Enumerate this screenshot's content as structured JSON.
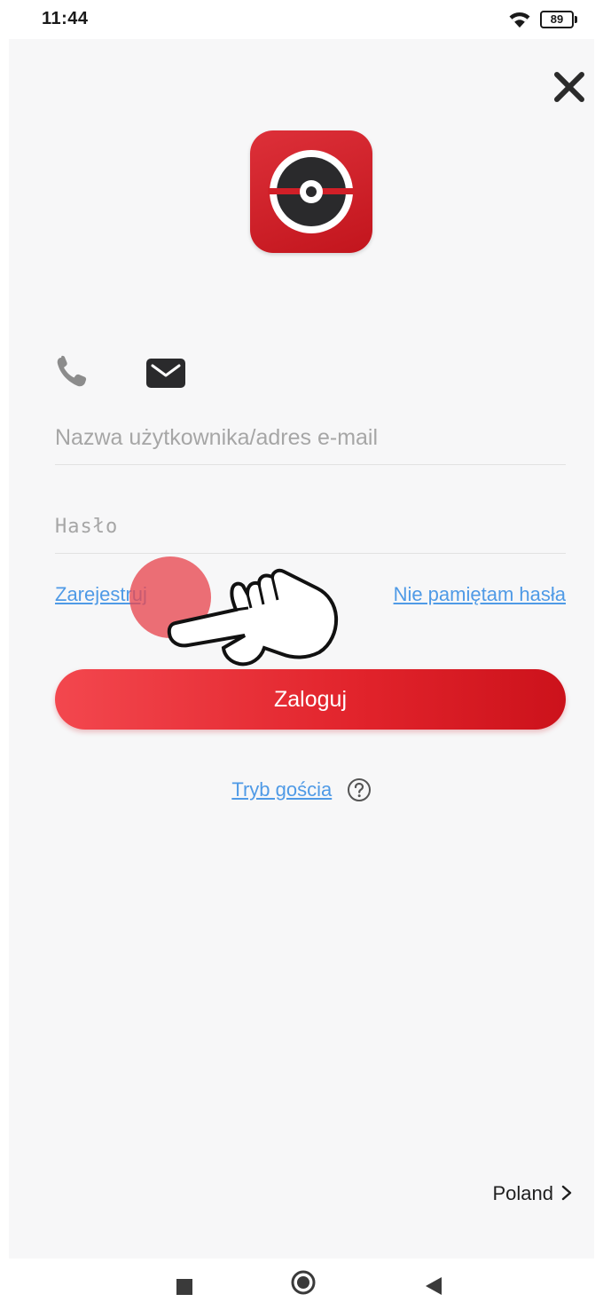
{
  "status_bar": {
    "time": "11:44",
    "battery_level": "89",
    "icons": [
      "wifi-icon",
      "battery-icon"
    ]
  },
  "app": {
    "logo_icon": "hik-connect-logo-icon",
    "close_icon": "close-icon",
    "tabs": [
      {
        "icon": "phone-icon",
        "selected": false
      },
      {
        "icon": "mail-icon",
        "selected": true
      }
    ],
    "username": {
      "value": "",
      "placeholder": "Nazwa użytkownika/adres e-mail"
    },
    "password": {
      "value": "",
      "placeholder": "Hasło"
    },
    "register_link": "Zarejestruj",
    "forgot_link": "Nie pamiętam hasła",
    "login_button": "Zaloguj",
    "guest_link": "Tryb gościa",
    "help_icon": "question-circle-icon",
    "region": "Poland"
  },
  "colors": {
    "brand_red": "#d9262e",
    "link_blue": "#4f9ae6",
    "background": "#f7f7f8"
  },
  "nav_bar": {
    "icons": [
      "square-recents-icon",
      "circle-home-icon",
      "triangle-back-icon"
    ]
  }
}
